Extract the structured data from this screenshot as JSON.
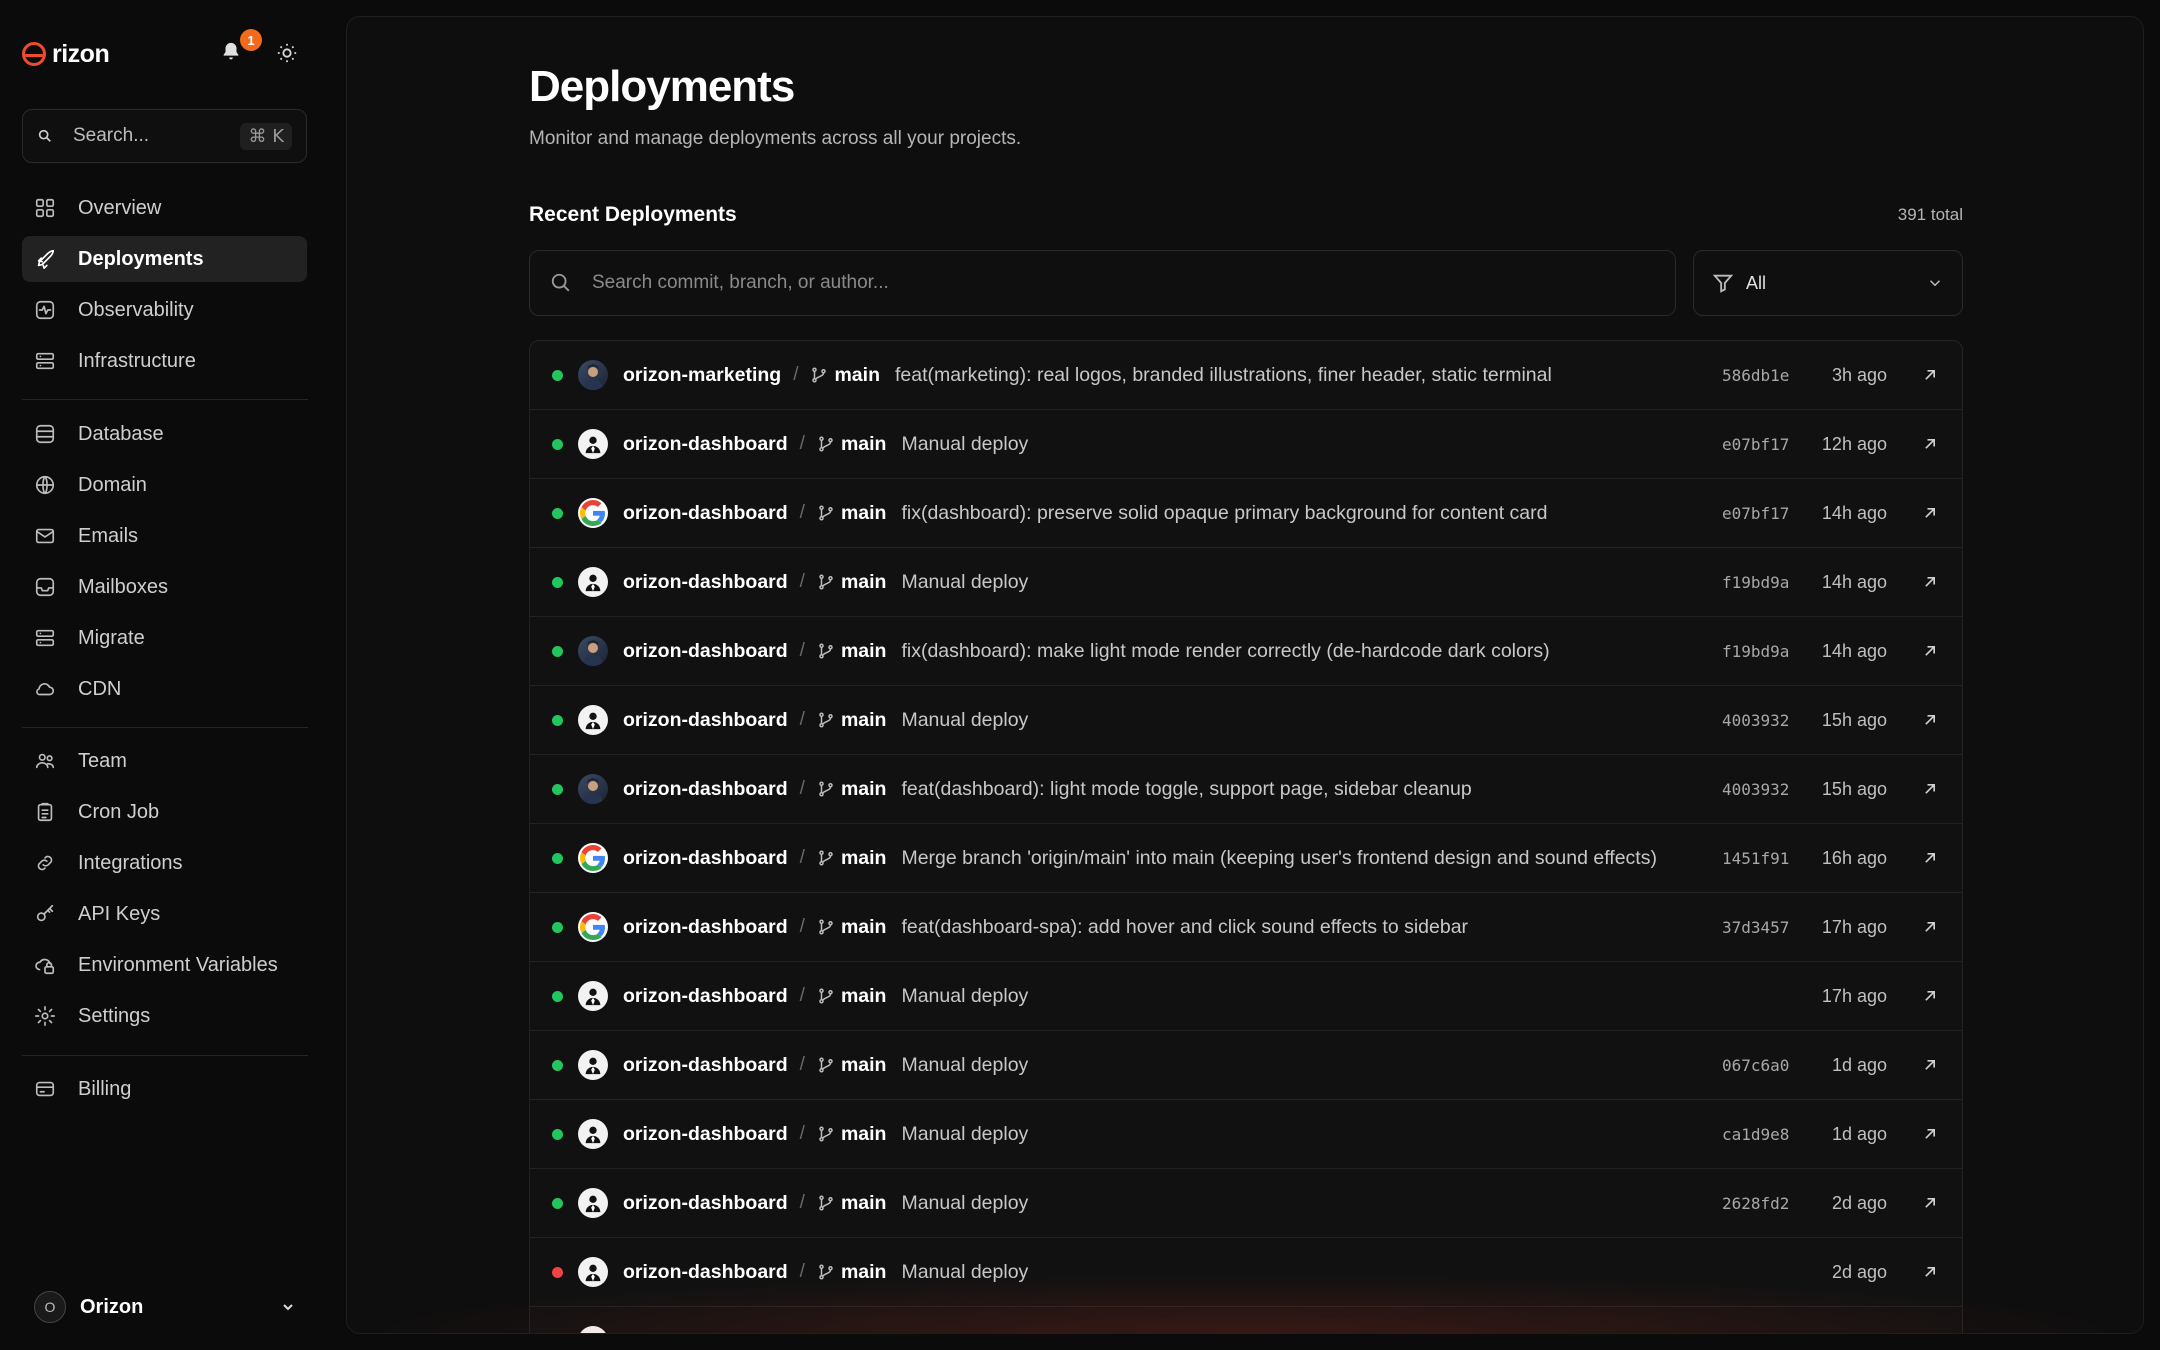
{
  "brand": {
    "name": "rizon",
    "notification_count": "1"
  },
  "sidebar": {
    "search_placeholder": "Search...",
    "search_shortcut": "⌘ K",
    "groups": [
      [
        {
          "label": "Overview",
          "icon": "grid-icon",
          "active": false
        },
        {
          "label": "Deployments",
          "icon": "rocket-icon",
          "active": true
        },
        {
          "label": "Observability",
          "icon": "activity-icon",
          "active": false
        },
        {
          "label": "Infrastructure",
          "icon": "server-icon",
          "active": false
        }
      ],
      [
        {
          "label": "Database",
          "icon": "database-icon",
          "active": false
        },
        {
          "label": "Domain",
          "icon": "globe-icon",
          "active": false
        },
        {
          "label": "Emails",
          "icon": "mail-icon",
          "active": false
        },
        {
          "label": "Mailboxes",
          "icon": "inbox-icon",
          "active": false
        },
        {
          "label": "Migrate",
          "icon": "server-icon",
          "active": false
        },
        {
          "label": "CDN",
          "icon": "cloud-icon",
          "active": false
        }
      ],
      [
        {
          "label": "Team",
          "icon": "users-icon",
          "active": false
        },
        {
          "label": "Cron Job",
          "icon": "clipboard-icon",
          "active": false
        },
        {
          "label": "Integrations",
          "icon": "link-icon",
          "active": false
        },
        {
          "label": "API Keys",
          "icon": "key-icon",
          "active": false
        },
        {
          "label": "Environment Variables",
          "icon": "cloud-lock-icon",
          "active": false
        },
        {
          "label": "Settings",
          "icon": "gear-icon",
          "active": false
        }
      ],
      [
        {
          "label": "Billing",
          "icon": "credit-card-icon",
          "active": false
        }
      ]
    ],
    "org": {
      "initial": "O",
      "name": "Orizon"
    }
  },
  "page": {
    "title": "Deployments",
    "subtitle": "Monitor and manage deployments across all your projects.",
    "section_title": "Recent Deployments",
    "total": "391 total",
    "search_placeholder": "Search commit, branch, or author...",
    "filter_value": "All"
  },
  "deployments": [
    {
      "status": "success",
      "avatar": "photo",
      "project": "orizon-marketing",
      "branch": "main",
      "message": "feat(marketing): real logos, branded illustrations, finer header, static terminal",
      "commit": "586db1e",
      "time": "3h ago"
    },
    {
      "status": "success",
      "avatar": "person",
      "project": "orizon-dashboard",
      "branch": "main",
      "message": "Manual deploy",
      "commit": "e07bf17",
      "time": "12h ago"
    },
    {
      "status": "success",
      "avatar": "google",
      "project": "orizon-dashboard",
      "branch": "main",
      "message": "fix(dashboard): preserve solid opaque primary background for content card",
      "commit": "e07bf17",
      "time": "14h ago"
    },
    {
      "status": "success",
      "avatar": "person",
      "project": "orizon-dashboard",
      "branch": "main",
      "message": "Manual deploy",
      "commit": "f19bd9a",
      "time": "14h ago"
    },
    {
      "status": "success",
      "avatar": "photo",
      "project": "orizon-dashboard",
      "branch": "main",
      "message": "fix(dashboard): make light mode render correctly (de-hardcode dark colors)",
      "commit": "f19bd9a",
      "time": "14h ago"
    },
    {
      "status": "success",
      "avatar": "person",
      "project": "orizon-dashboard",
      "branch": "main",
      "message": "Manual deploy",
      "commit": "4003932",
      "time": "15h ago"
    },
    {
      "status": "success",
      "avatar": "photo",
      "project": "orizon-dashboard",
      "branch": "main",
      "message": "feat(dashboard): light mode toggle, support page, sidebar cleanup",
      "commit": "4003932",
      "time": "15h ago"
    },
    {
      "status": "success",
      "avatar": "google",
      "project": "orizon-dashboard",
      "branch": "main",
      "message": "Merge branch 'origin/main' into main (keeping user's frontend design and sound effects)",
      "commit": "1451f91",
      "time": "16h ago"
    },
    {
      "status": "success",
      "avatar": "google",
      "project": "orizon-dashboard",
      "branch": "main",
      "message": "feat(dashboard-spa): add hover and click sound effects to sidebar",
      "commit": "37d3457",
      "time": "17h ago"
    },
    {
      "status": "success",
      "avatar": "person",
      "project": "orizon-dashboard",
      "branch": "main",
      "message": "Manual deploy",
      "commit": "",
      "time": "17h ago"
    },
    {
      "status": "success",
      "avatar": "person",
      "project": "orizon-dashboard",
      "branch": "main",
      "message": "Manual deploy",
      "commit": "067c6a0",
      "time": "1d ago"
    },
    {
      "status": "success",
      "avatar": "person",
      "project": "orizon-dashboard",
      "branch": "main",
      "message": "Manual deploy",
      "commit": "ca1d9e8",
      "time": "1d ago"
    },
    {
      "status": "success",
      "avatar": "person",
      "project": "orizon-dashboard",
      "branch": "main",
      "message": "Manual deploy",
      "commit": "2628fd2",
      "time": "2d ago"
    },
    {
      "status": "failed",
      "avatar": "person",
      "project": "orizon-dashboard",
      "branch": "main",
      "message": "Manual deploy",
      "commit": "",
      "time": "2d ago"
    },
    {
      "status": "failed",
      "avatar": "person",
      "project": "",
      "branch": "",
      "message": "",
      "commit": "",
      "time": ""
    }
  ],
  "colors": {
    "accent": "#ef4c2b",
    "success": "#22c55e",
    "failed": "#ef4444",
    "badge": "#f26a1b"
  }
}
